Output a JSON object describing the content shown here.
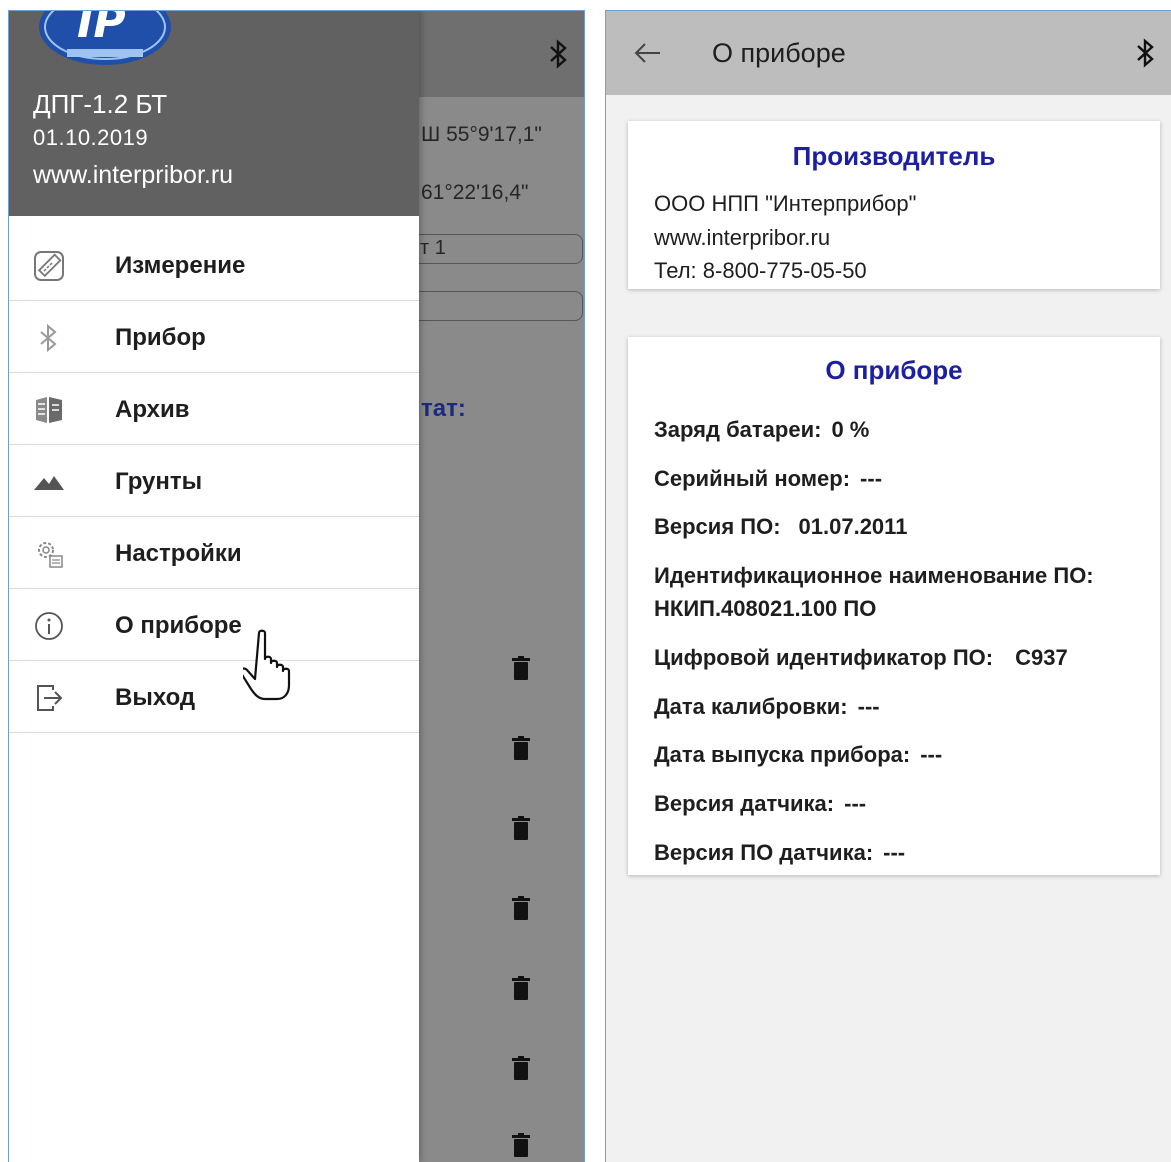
{
  "left_screen": {
    "background": {
      "gps_lat": "Ш 55°9'17,1\"",
      "gps_lon": "61°22'16,4\"",
      "field_value": "т 1",
      "result_label": "тат:"
    },
    "drawer": {
      "header": {
        "device_name": "ДПГ-1.2 БТ",
        "date": "01.10.2019",
        "website": "www.interpribor.ru"
      },
      "menu": [
        {
          "label": "Измерение",
          "icon": "ruler-icon"
        },
        {
          "label": "Прибор",
          "icon": "bluetooth-icon"
        },
        {
          "label": "Архив",
          "icon": "archive-icon"
        },
        {
          "label": "Грунты",
          "icon": "mountains-icon"
        },
        {
          "label": "Настройки",
          "icon": "settings-icon"
        },
        {
          "label": "О приборе",
          "icon": "info-icon"
        },
        {
          "label": "Выход",
          "icon": "exit-icon"
        }
      ]
    }
  },
  "right_screen": {
    "toolbar": {
      "title": "О приборе"
    },
    "manufacturer_card": {
      "title": "Производитель",
      "company": "ООО НПП \"Интерприбор\"",
      "website": "www.interpribor.ru",
      "phone": "Тел: 8-800-775-05-50"
    },
    "device_card": {
      "title": "О приборе",
      "battery_label": "Заряд батареи:",
      "battery_value": "0 %",
      "serial_label": "Серийный номер:",
      "serial_value": "---",
      "firmware_label": "Версия ПО:",
      "firmware_value": "01.07.2011",
      "sw_id_label": "Идентификационное наименование ПО:",
      "sw_id_value": "НКИП.408021.100 ПО",
      "digital_id_label": "Цифровой идентификатор ПО:",
      "digital_id_value": "C937",
      "calibration_label": "Дата калибровки:",
      "calibration_value": "---",
      "release_label": "Дата выпуска прибора:",
      "release_value": "---",
      "sensor_version_label": "Версия датчика:",
      "sensor_version_value": "---",
      "sensor_fw_label": "Версия ПО датчика:",
      "sensor_fw_value": "---"
    }
  },
  "colors": {
    "accent_title": "#1b1fa0",
    "drawer_header": "#616161",
    "toolbar_gray": "#bdbdbd",
    "scrim": "#8a8a8a"
  }
}
